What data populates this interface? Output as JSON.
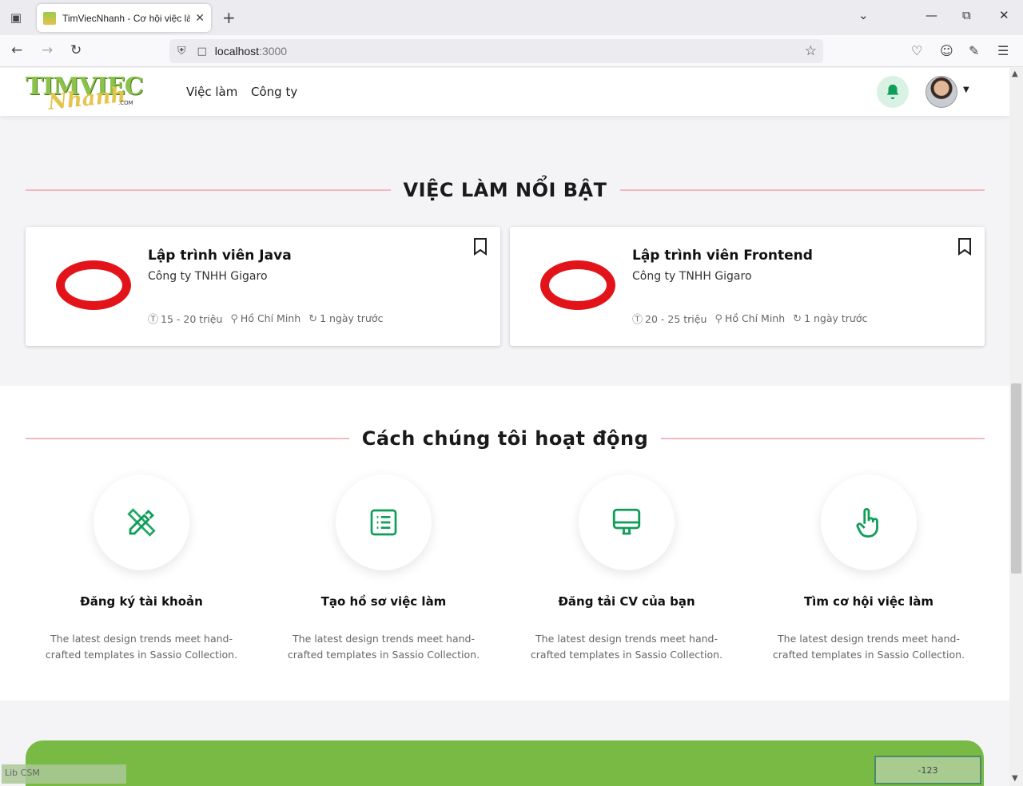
{
  "browser": {
    "tab_title": "TimViecNhanh - Cơ hội việc làm",
    "new_tab_icon": "+",
    "url_host": "localhost",
    "url_port": ":3000"
  },
  "site": {
    "logo_main": "TIMVIEC",
    "logo_sub": "Nhanh",
    "logo_com": ".COM",
    "menu": [
      {
        "label": "Việc làm"
      },
      {
        "label": "Công ty"
      }
    ]
  },
  "featured": {
    "title": "VIỆC LÀM NỔI BẬT",
    "jobs": [
      {
        "title": "Lập trình viên Java",
        "company": "Công ty TNHH Gigaro",
        "salary": "15 - 20 triệu",
        "location": "Hồ Chí Minh",
        "posted": "1 ngày trước"
      },
      {
        "title": "Lập trình viên Frontend",
        "company": "Công ty TNHH Gigaro",
        "salary": "20 - 25 triệu",
        "location": "Hồ Chí Minh",
        "posted": "1 ngày trước"
      }
    ]
  },
  "how": {
    "title": "Cách chúng tôi hoạt động",
    "steps": [
      {
        "icon": "pencil-ruler-icon",
        "title": "Đăng ký tài khoản",
        "desc": "The latest design trends meet hand-crafted templates in Sassio Collection."
      },
      {
        "icon": "list-icon",
        "title": "Tạo hồ sơ việc làm",
        "desc": "The latest design trends meet hand-crafted templates in Sassio Collection."
      },
      {
        "icon": "monitor-icon",
        "title": "Đăng tải CV của bạn",
        "desc": "The latest design trends meet hand-crafted templates in Sassio Collection."
      },
      {
        "icon": "pointer-hand-icon",
        "title": "Tìm cơ hội việc làm",
        "desc": "The latest design trends meet hand-crafted templates in Sassio Collection."
      }
    ]
  },
  "overlays": {
    "left_label": "Lib CSM",
    "right_label": "-123"
  },
  "colors": {
    "accent_green": "#0f9d58",
    "banner_green": "#78ba44",
    "divider_pink": "#f2b8c0",
    "oracle_red": "#e2141a"
  }
}
